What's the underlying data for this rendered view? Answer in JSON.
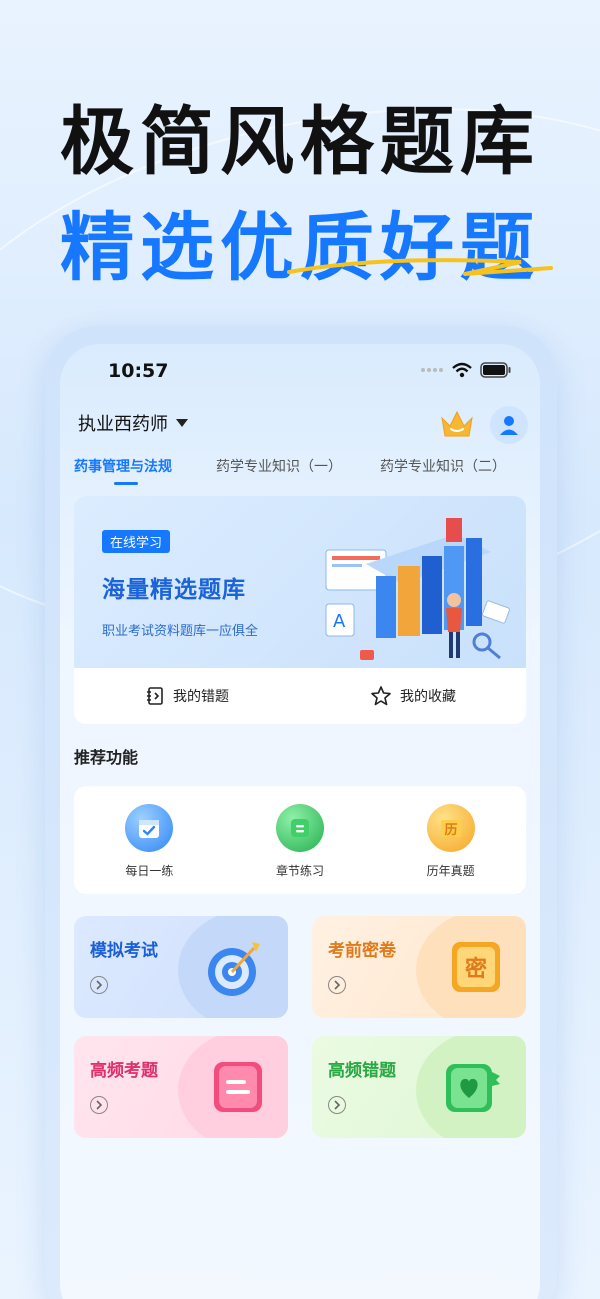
{
  "promo": {
    "headline_1": "极简风格题库",
    "headline_2": "精选优质好题",
    "accent_color": "#1677ff"
  },
  "status_bar": {
    "time": "10:57"
  },
  "header": {
    "exam_selector": "执业西药师",
    "crown_icon": "vip-crown-icon",
    "avatar_icon": "user-avatar-icon"
  },
  "tabs": [
    {
      "label": "药事管理与法规",
      "active": true
    },
    {
      "label": "药学专业知识（一）",
      "active": false
    },
    {
      "label": "药学专业知识（二）",
      "active": false
    }
  ],
  "banner": {
    "tag": "在线学习",
    "title": "海量精选题库",
    "subtitle": "职业考试资料题库一应俱全",
    "actions": [
      {
        "label": "我的错题",
        "icon": "notebook-icon"
      },
      {
        "label": "我的收藏",
        "icon": "star-icon"
      }
    ]
  },
  "section_title": "推荐功能",
  "features": [
    {
      "label": "每日一练",
      "icon": "calendar-check-icon",
      "color": "#3a8bff"
    },
    {
      "label": "章节练习",
      "icon": "list-icon",
      "color": "#2fbf5a"
    },
    {
      "label": "历年真题",
      "icon": "history-icon",
      "color": "#f5a623",
      "glyph": "历"
    }
  ],
  "modules": [
    {
      "title": "模拟考试",
      "icon": "target-icon",
      "color": "#1a5fd8"
    },
    {
      "title": "考前密卷",
      "icon": "secret-paper-icon",
      "color": "#e07a1a",
      "glyph": "密"
    },
    {
      "title": "高频考题",
      "icon": "document-icon",
      "color": "#e0306a"
    },
    {
      "title": "高频错题",
      "icon": "heart-book-icon",
      "color": "#2aa844"
    }
  ]
}
